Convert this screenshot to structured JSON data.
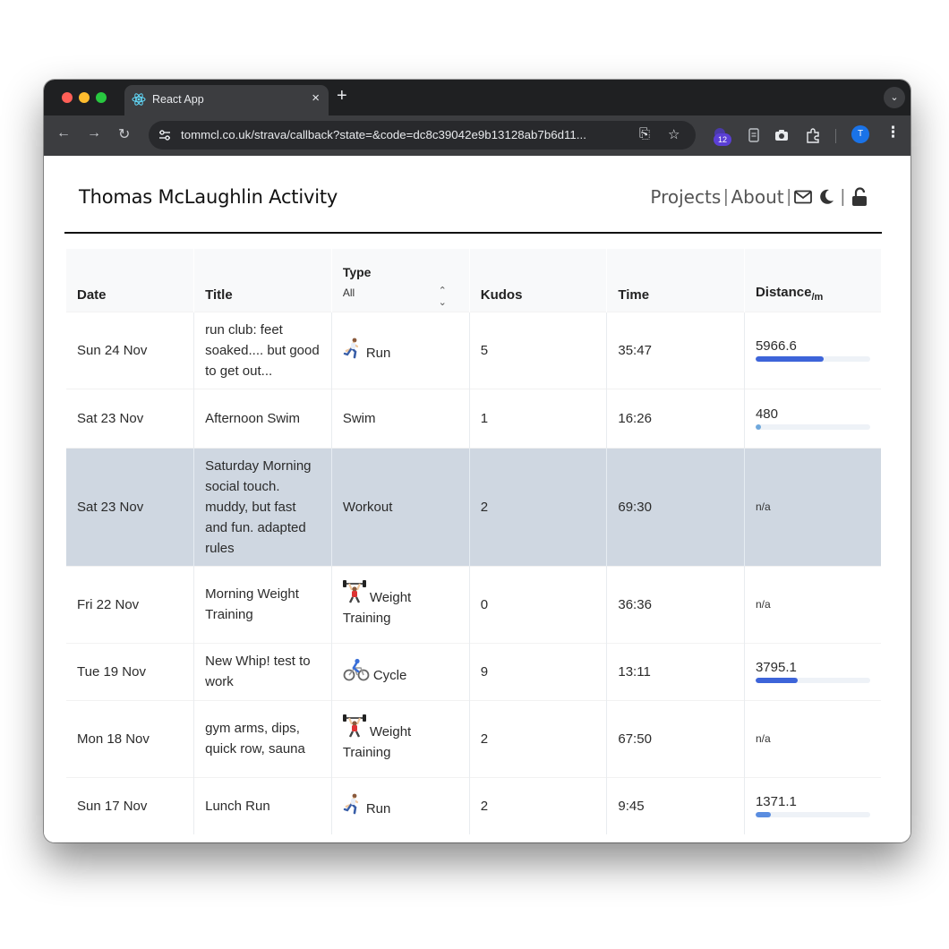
{
  "browser": {
    "tab_title": "React App",
    "url": "tommcl.co.uk/strava/callback?state=&code=dc8c39042e9b13128ab7b6d11...",
    "extension_badge": "12",
    "profile_initial": "T"
  },
  "site": {
    "title": "Thomas McLaughlin Activity",
    "nav": {
      "projects": "Projects",
      "about": "About"
    }
  },
  "table": {
    "headers": {
      "date": "Date",
      "title": "Title",
      "type": "Type",
      "type_filter": "All",
      "kudos": "Kudos",
      "time": "Time",
      "distance": "Distance",
      "distance_unit": "/m"
    },
    "rows": [
      {
        "date": "Sun 24 Nov",
        "title": "run club: feet soaked.... but good to get out...",
        "type": "Run",
        "type_icon": "runner-icon",
        "kudos": "5",
        "time": "35:47",
        "distance": "5966.6",
        "distance_fraction": 0.59,
        "bar_color": "#3d64d9"
      },
      {
        "date": "Sat 23 Nov",
        "title": "Afternoon Swim",
        "type": "Swim",
        "type_icon": "",
        "kudos": "1",
        "time": "16:26",
        "distance": "480",
        "distance_fraction": 0.05,
        "bar_color": "#6fa8dc"
      },
      {
        "date": "Sat 23 Nov",
        "title": "Saturday Morning social touch. muddy, but fast and fun. adapted rules",
        "type": "Workout",
        "type_icon": "",
        "kudos": "2",
        "time": "69:30",
        "distance": "n/a",
        "distance_fraction": null,
        "highlighted": true
      },
      {
        "date": "Fri 22 Nov",
        "title": "Morning Weight Training",
        "type": "Weight Training",
        "type_icon": "weightlifter-icon",
        "kudos": "0",
        "time": "36:36",
        "distance": "n/a",
        "distance_fraction": null
      },
      {
        "date": "Tue 19 Nov",
        "title": "New Whip! test to work",
        "type": "Cycle",
        "type_icon": "cyclist-icon",
        "kudos": "9",
        "time": "13:11",
        "distance": "3795.1",
        "distance_fraction": 0.37,
        "bar_color": "#3d64d9"
      },
      {
        "date": "Mon 18 Nov",
        "title": "gym arms, dips, quick row, sauna",
        "type": "Weight Training",
        "type_icon": "weightlifter-icon",
        "kudos": "2",
        "time": "67:50",
        "distance": "n/a",
        "distance_fraction": null
      },
      {
        "date": "Sun 17 Nov",
        "title": "Lunch Run",
        "type": "Run",
        "type_icon": "runner-icon",
        "kudos": "2",
        "time": "9:45",
        "distance": "1371.1",
        "distance_fraction": 0.13,
        "bar_color": "#5a8de0"
      }
    ]
  }
}
